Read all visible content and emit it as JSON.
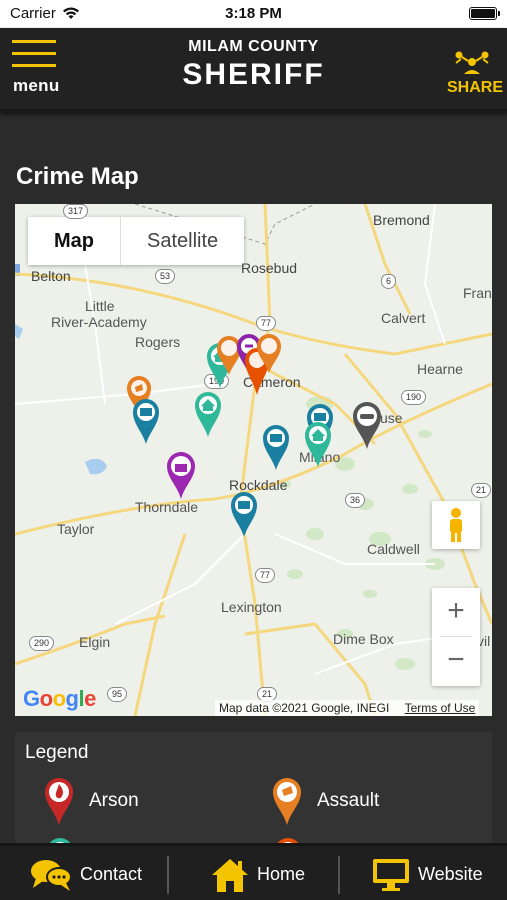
{
  "status_bar": {
    "carrier": "Carrier",
    "time": "3:18 PM"
  },
  "header": {
    "menu_label": "menu",
    "county": "MILAM COUNTY",
    "title": "SHERIFF",
    "share_label": "SHARE"
  },
  "section_title": "Crime Map",
  "map": {
    "toggle": {
      "map": "Map",
      "satellite": "Satellite"
    },
    "places": {
      "bremond": "Bremond",
      "belton": "Belton",
      "rosebud": "Rosebud",
      "little": "Little",
      "river_academy": "River-Academy",
      "rogers": "Rogers",
      "calvert": "Calvert",
      "fran": "Fran",
      "hearne": "Hearne",
      "cameron": "Cameron",
      "use": "use",
      "milano": "Milano",
      "rockdale": "Rockdale",
      "thorndale": "Thorndale",
      "taylor": "Taylor",
      "caldwell": "Caldwell",
      "lexington": "Lexington",
      "elgin": "Elgin",
      "dime_box": "Dime Box",
      "vil": "vil"
    },
    "highways": {
      "h317": "317",
      "h53": "53",
      "h6": "6",
      "h77a": "77",
      "h190a": "190",
      "h190b": "190",
      "h36": "36",
      "h21a": "21",
      "h77b": "77",
      "h290": "290",
      "h95": "95",
      "h21b": "21"
    },
    "attribution": "Map data ©2021 Google, INEGI",
    "terms": "Terms of Use",
    "google_letters": [
      "G",
      "o",
      "o",
      "g",
      "l",
      "e"
    ],
    "zoom_in": "+",
    "zoom_out": "−"
  },
  "legend": {
    "title": "Legend",
    "items": [
      {
        "label": "Arson",
        "color": "#c62828",
        "icon": "fire-icon"
      },
      {
        "label": "Assault",
        "color": "#e67e22",
        "icon": "fist-icon"
      }
    ]
  },
  "bottom_bar": {
    "contact": "Contact",
    "home": "Home",
    "website": "Website"
  },
  "colors": {
    "accent": "#f4c400",
    "header_bg": "#222222",
    "page_bg": "#2b2b2b",
    "pin_teal": "#2fb89a",
    "pin_blue": "#1a7fa0",
    "pin_orange": "#e67e22",
    "pin_purple": "#8e24aa",
    "pin_gray": "#555555"
  }
}
